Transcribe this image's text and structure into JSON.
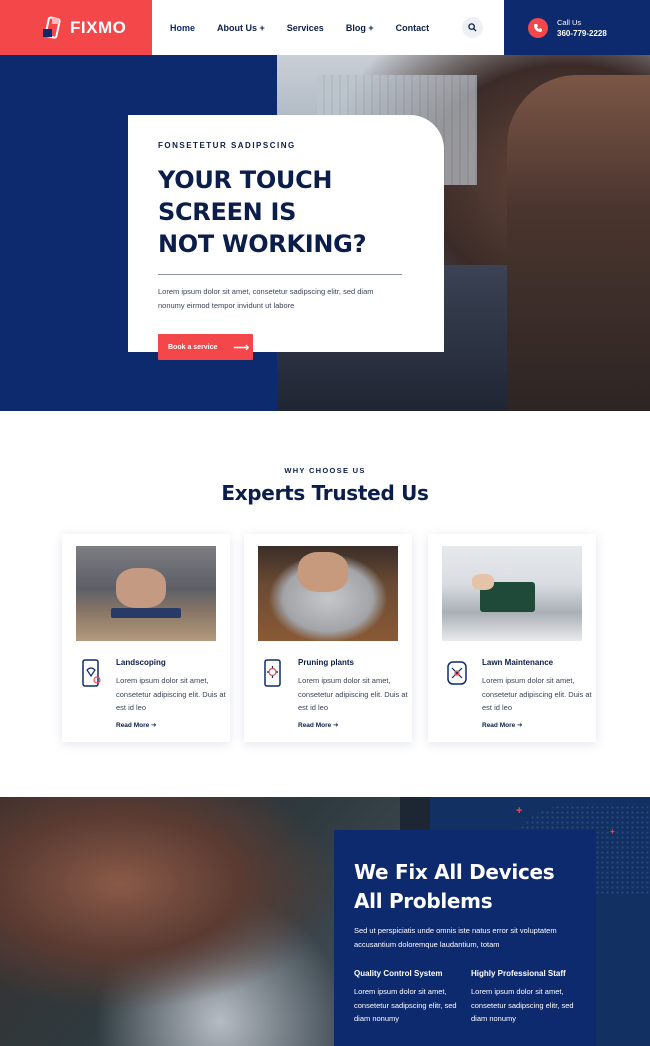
{
  "header": {
    "logo_text": "FIXMO",
    "nav": [
      "Home",
      "About Us +",
      "Services",
      "Blog +",
      "Contact"
    ],
    "call_label": "Call Us",
    "call_number": "360-779-2228"
  },
  "hero": {
    "eyebrow": "FONSETETUR SADIPSCING",
    "title_line1": "YOUR TOUCH SCREEN IS",
    "title_line2": "NOT WORKING?",
    "text": "Lorem ipsum dolor sit amet, consetetur sadipscing elitr, sed diam nonumy eirmod tempor invidunt ut labore",
    "button_label": "Book a service"
  },
  "why": {
    "eyebrow": "WHY CHOOSE US",
    "title": "Experts Trusted Us",
    "cards": [
      {
        "title": "Landscoping",
        "text": "Lorem ipsum dolor sit amet, consetetur adipiscing elit. Duis at est id leo",
        "link": "Read More"
      },
      {
        "title": "Pruning plants",
        "text": "Lorem ipsum dolor sit amet, consetetur adipiscing elit. Duis at est id leo",
        "link": "Read More"
      },
      {
        "title": "Lawn Maintenance",
        "text": "Lorem ipsum dolor sit amet, consetetur adipiscing elit. Duis at est id leo",
        "link": "Read More"
      }
    ]
  },
  "fix": {
    "title_line1": "We Fix All Devices",
    "title_line2": "All Problems",
    "text": "Sed ut perspiciatis unde omnis iste natus error sit voluptatem accusantium doloremque laudantium, totam",
    "features": [
      {
        "title": "Quality Control System",
        "text": "Lorem ipsum dolor sit amet, consetetur sadipscing elitr, sed diam nonumy"
      },
      {
        "title": "Highly Professional Staff",
        "text": "Lorem ipsum dolor sit amet, consetetur sadipscing elitr, sed diam nonumy"
      }
    ]
  },
  "colors": {
    "primary": "#0e2a6e",
    "accent": "#f4474a",
    "text": "#0b1d4a"
  },
  "icons": [
    "logo-phone-icon",
    "search-icon",
    "phone-icon",
    "arrow-right-icon",
    "phone-repair-icon",
    "tablet-repair-icon",
    "circuit-icon"
  ]
}
